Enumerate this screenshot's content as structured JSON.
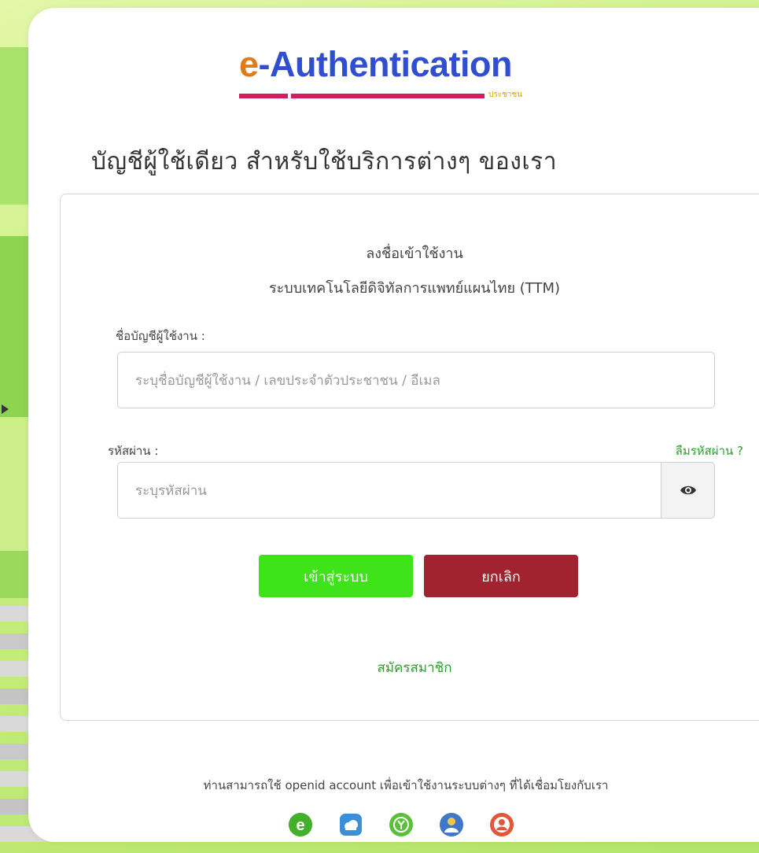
{
  "logo": {
    "text_e": "e",
    "text_rest": "-Authentication",
    "sub": "ประชาชน"
  },
  "headline": "บัญชีผู้ใช้เดียว สำหรับใช้บริการต่างๆ ของเรา",
  "login": {
    "title": "ลงชื่อเข้าใช้งาน",
    "subtitle": "ระบบเทคโนโลยีดิจิทัลการแพทย์แผนไทย (TTM)",
    "username_label": "ชื่อบัญชีผู้ใช้งาน :",
    "username_placeholder": "ระบุชื่อบัญชีผู้ใช้งาน / เลขประจำตัวประชาชน / อีเมล",
    "password_label": "รหัสผ่าน :",
    "password_placeholder": "ระบุรหัสผ่าน",
    "forgot_label": "ลืมรหัสผ่าน ?",
    "submit_label": "เข้าสู่ระบบ",
    "cancel_label": "ยกเลิก",
    "register_label": "สมัครสมาชิก"
  },
  "footer": {
    "text": "ท่านสามารถใช้ openid account เพื่อเข้าใช้งานระบบต่างๆ ที่ได้เชื่อมโยงกับเรา",
    "providers": [
      {
        "icon": "e-icon",
        "color": "#43b02a"
      },
      {
        "icon": "cloud-icon",
        "color": "#3a8fd8"
      },
      {
        "icon": "y-icon",
        "color": "#5bbf3a"
      },
      {
        "icon": "person-icon",
        "color": "#3f78c8"
      },
      {
        "icon": "person-circle-icon",
        "color": "#e2563a"
      }
    ]
  },
  "colors": {
    "brand_blue": "#2f4fd0",
    "brand_orange": "#e07a1c",
    "brand_magenta": "#d91a5d",
    "submit_green": "#3ee419",
    "cancel_red": "#a0232f",
    "link_green": "#2aa02a"
  }
}
